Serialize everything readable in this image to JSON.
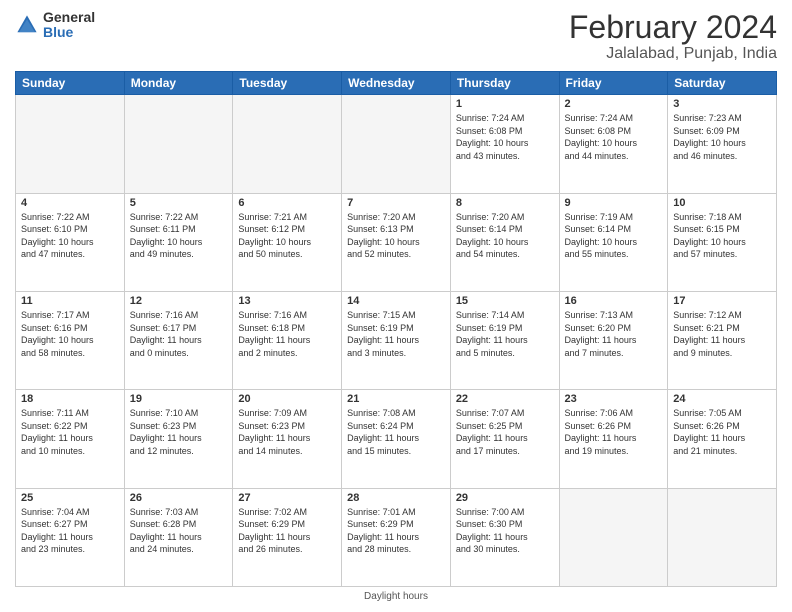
{
  "header": {
    "logo_general": "General",
    "logo_blue": "Blue",
    "title": "February 2024",
    "subtitle": "Jalalabad, Punjab, India"
  },
  "days_of_week": [
    "Sunday",
    "Monday",
    "Tuesday",
    "Wednesday",
    "Thursday",
    "Friday",
    "Saturday"
  ],
  "weeks": [
    [
      {
        "day": "",
        "info": "",
        "empty": true
      },
      {
        "day": "",
        "info": "",
        "empty": true
      },
      {
        "day": "",
        "info": "",
        "empty": true
      },
      {
        "day": "",
        "info": "",
        "empty": true
      },
      {
        "day": "1",
        "info": "Sunrise: 7:24 AM\nSunset: 6:08 PM\nDaylight: 10 hours\nand 43 minutes."
      },
      {
        "day": "2",
        "info": "Sunrise: 7:24 AM\nSunset: 6:08 PM\nDaylight: 10 hours\nand 44 minutes."
      },
      {
        "day": "3",
        "info": "Sunrise: 7:23 AM\nSunset: 6:09 PM\nDaylight: 10 hours\nand 46 minutes."
      }
    ],
    [
      {
        "day": "4",
        "info": "Sunrise: 7:22 AM\nSunset: 6:10 PM\nDaylight: 10 hours\nand 47 minutes."
      },
      {
        "day": "5",
        "info": "Sunrise: 7:22 AM\nSunset: 6:11 PM\nDaylight: 10 hours\nand 49 minutes."
      },
      {
        "day": "6",
        "info": "Sunrise: 7:21 AM\nSunset: 6:12 PM\nDaylight: 10 hours\nand 50 minutes."
      },
      {
        "day": "7",
        "info": "Sunrise: 7:20 AM\nSunset: 6:13 PM\nDaylight: 10 hours\nand 52 minutes."
      },
      {
        "day": "8",
        "info": "Sunrise: 7:20 AM\nSunset: 6:14 PM\nDaylight: 10 hours\nand 54 minutes."
      },
      {
        "day": "9",
        "info": "Sunrise: 7:19 AM\nSunset: 6:14 PM\nDaylight: 10 hours\nand 55 minutes."
      },
      {
        "day": "10",
        "info": "Sunrise: 7:18 AM\nSunset: 6:15 PM\nDaylight: 10 hours\nand 57 minutes."
      }
    ],
    [
      {
        "day": "11",
        "info": "Sunrise: 7:17 AM\nSunset: 6:16 PM\nDaylight: 10 hours\nand 58 minutes."
      },
      {
        "day": "12",
        "info": "Sunrise: 7:16 AM\nSunset: 6:17 PM\nDaylight: 11 hours\nand 0 minutes."
      },
      {
        "day": "13",
        "info": "Sunrise: 7:16 AM\nSunset: 6:18 PM\nDaylight: 11 hours\nand 2 minutes."
      },
      {
        "day": "14",
        "info": "Sunrise: 7:15 AM\nSunset: 6:19 PM\nDaylight: 11 hours\nand 3 minutes."
      },
      {
        "day": "15",
        "info": "Sunrise: 7:14 AM\nSunset: 6:19 PM\nDaylight: 11 hours\nand 5 minutes."
      },
      {
        "day": "16",
        "info": "Sunrise: 7:13 AM\nSunset: 6:20 PM\nDaylight: 11 hours\nand 7 minutes."
      },
      {
        "day": "17",
        "info": "Sunrise: 7:12 AM\nSunset: 6:21 PM\nDaylight: 11 hours\nand 9 minutes."
      }
    ],
    [
      {
        "day": "18",
        "info": "Sunrise: 7:11 AM\nSunset: 6:22 PM\nDaylight: 11 hours\nand 10 minutes."
      },
      {
        "day": "19",
        "info": "Sunrise: 7:10 AM\nSunset: 6:23 PM\nDaylight: 11 hours\nand 12 minutes."
      },
      {
        "day": "20",
        "info": "Sunrise: 7:09 AM\nSunset: 6:23 PM\nDaylight: 11 hours\nand 14 minutes."
      },
      {
        "day": "21",
        "info": "Sunrise: 7:08 AM\nSunset: 6:24 PM\nDaylight: 11 hours\nand 15 minutes."
      },
      {
        "day": "22",
        "info": "Sunrise: 7:07 AM\nSunset: 6:25 PM\nDaylight: 11 hours\nand 17 minutes."
      },
      {
        "day": "23",
        "info": "Sunrise: 7:06 AM\nSunset: 6:26 PM\nDaylight: 11 hours\nand 19 minutes."
      },
      {
        "day": "24",
        "info": "Sunrise: 7:05 AM\nSunset: 6:26 PM\nDaylight: 11 hours\nand 21 minutes."
      }
    ],
    [
      {
        "day": "25",
        "info": "Sunrise: 7:04 AM\nSunset: 6:27 PM\nDaylight: 11 hours\nand 23 minutes."
      },
      {
        "day": "26",
        "info": "Sunrise: 7:03 AM\nSunset: 6:28 PM\nDaylight: 11 hours\nand 24 minutes."
      },
      {
        "day": "27",
        "info": "Sunrise: 7:02 AM\nSunset: 6:29 PM\nDaylight: 11 hours\nand 26 minutes."
      },
      {
        "day": "28",
        "info": "Sunrise: 7:01 AM\nSunset: 6:29 PM\nDaylight: 11 hours\nand 28 minutes."
      },
      {
        "day": "29",
        "info": "Sunrise: 7:00 AM\nSunset: 6:30 PM\nDaylight: 11 hours\nand 30 minutes."
      },
      {
        "day": "",
        "info": "",
        "empty": true
      },
      {
        "day": "",
        "info": "",
        "empty": true
      }
    ]
  ],
  "footer": "Daylight hours"
}
